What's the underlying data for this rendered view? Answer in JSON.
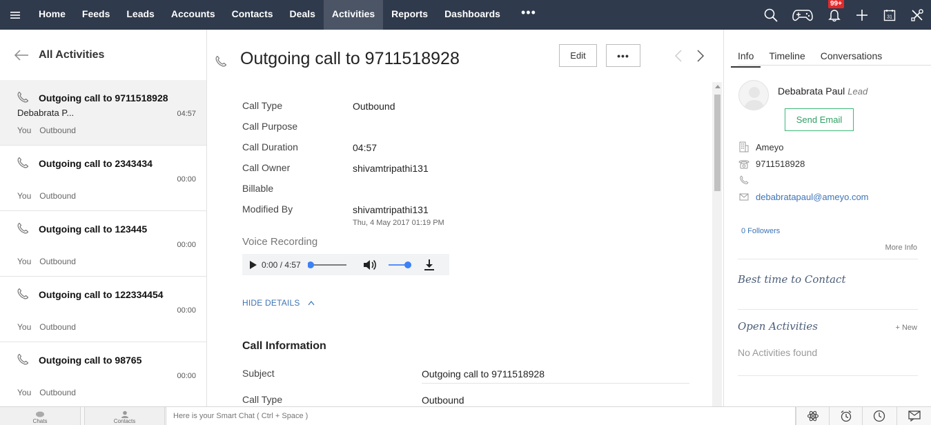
{
  "nav": {
    "items": [
      {
        "label": "Home",
        "active": false
      },
      {
        "label": "Feeds",
        "active": false
      },
      {
        "label": "Leads",
        "active": false
      },
      {
        "label": "Accounts",
        "active": false
      },
      {
        "label": "Contacts",
        "active": false
      },
      {
        "label": "Deals",
        "active": false
      },
      {
        "label": "Activities",
        "active": true
      },
      {
        "label": "Reports",
        "active": false
      },
      {
        "label": "Dashboards",
        "active": false
      }
    ],
    "more_label": "•••",
    "notification_badge": "99+",
    "calendar_day": "31"
  },
  "left_panel": {
    "title": "All Activities",
    "items": [
      {
        "title": "Outgoing call to 9711518928",
        "contact": "Debabrata P...",
        "time": "04:57",
        "owner": "You",
        "type": "Outbound",
        "selected": true
      },
      {
        "title": "Outgoing call to 2343434",
        "contact": "",
        "time": "00:00",
        "owner": "You",
        "type": "Outbound",
        "selected": false
      },
      {
        "title": "Outgoing call to 123445",
        "contact": "",
        "time": "00:00",
        "owner": "You",
        "type": "Outbound",
        "selected": false
      },
      {
        "title": "Outgoing call to 122334454",
        "contact": "",
        "time": "00:00",
        "owner": "You",
        "type": "Outbound",
        "selected": false
      },
      {
        "title": "Outgoing call to 98765",
        "contact": "",
        "time": "00:00",
        "owner": "You",
        "type": "Outbound",
        "selected": false
      }
    ]
  },
  "record": {
    "title": "Outgoing call to 9711518928",
    "edit_label": "Edit",
    "more_label": "•••",
    "fields": {
      "call_type": {
        "label": "Call Type",
        "value": "Outbound"
      },
      "call_purpose": {
        "label": "Call Purpose",
        "value": ""
      },
      "call_duration": {
        "label": "Call Duration",
        "value": "04:57"
      },
      "call_owner": {
        "label": "Call Owner",
        "value": "shivamtripathi131"
      },
      "billable": {
        "label": "Billable",
        "value": ""
      },
      "modified_by": {
        "label": "Modified By",
        "value": "shivamtripathi131",
        "date": "Thu, 4 May 2017 01:19 PM"
      }
    },
    "voice_recording": {
      "label": "Voice Recording",
      "time": "0:00 / 4:57",
      "progress": 0,
      "volume": 1
    },
    "hide_details_label": "HIDE DETAILS",
    "call_info": {
      "title": "Call Information",
      "subject": {
        "label": "Subject",
        "value": "Outgoing call to 9711518928"
      },
      "call_type": {
        "label": "Call Type",
        "value": "Outbound"
      }
    }
  },
  "right_panel": {
    "tabs": [
      {
        "label": "Info",
        "active": true
      },
      {
        "label": "Timeline",
        "active": false
      },
      {
        "label": "Conversations",
        "active": false
      }
    ],
    "contact": {
      "name": "Debabrata Paul",
      "type": "Lead",
      "send_email_label": "Send Email",
      "company": "Ameyo",
      "phone": "9711518928",
      "mobile": "",
      "email": "debabratapaul@ameyo.com"
    },
    "followers": "0 Followers",
    "more_info": "More Info",
    "best_time_heading": "Best time to Contact",
    "open_activities_heading": "Open Activities",
    "new_label": "+ New",
    "no_activities": "No Activities found"
  },
  "bottom_bar": {
    "chats_label": "Chats",
    "contacts_label": "Contacts",
    "smart_chat_placeholder": "Here is your Smart Chat ( Ctrl + Space )"
  },
  "colors": {
    "nav_bg": "#2f3a4c",
    "nav_active": "#4b5566",
    "link": "#3d74b5",
    "accent_green": "#3db67a",
    "badge_red": "#e4292b",
    "player_blue": "#3b82f6"
  }
}
